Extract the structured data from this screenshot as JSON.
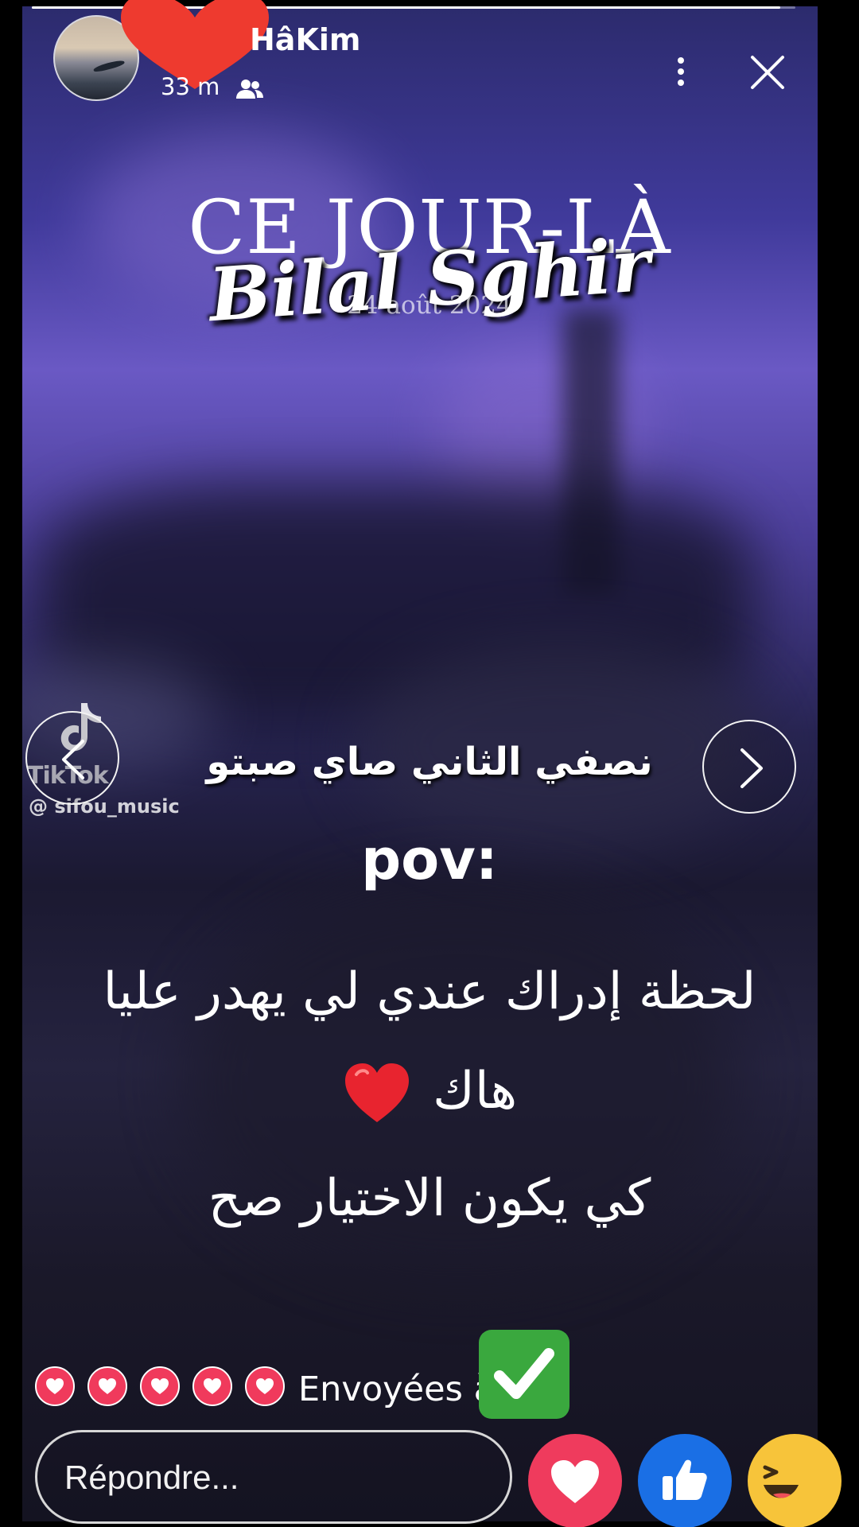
{
  "header": {
    "username": "HâKim",
    "timestamp": "33 m",
    "audience_icon": "friends-icon",
    "more_icon": "more-vertical-icon",
    "close_icon": "close-icon"
  },
  "progress": {
    "value": 0.98
  },
  "story": {
    "title": "CE JOUR-LÀ",
    "artist": "Bilal Sghir",
    "date": "24 août 2024",
    "watermark_brand": "TikTok",
    "watermark_handle": "@ sifou_music",
    "lyric": "نصفي الثاني صاي صبتو",
    "pov": "pov:",
    "line1": "لحظة إدراك عندي لي يهدر عليا",
    "line2": "هاك",
    "line3": "كي يكون الاختيار صح",
    "prev_icon": "chevron-left-icon",
    "next_icon": "chevron-right-icon"
  },
  "footer": {
    "reaction_hearts": [
      "heart-icon",
      "heart-icon",
      "heart-icon",
      "heart-icon",
      "heart-icon"
    ],
    "sent_to_label": "Envoyées à",
    "reply_placeholder": "Répondre...",
    "quick_reactions": [
      "love-icon",
      "like-icon",
      "haha-icon"
    ]
  },
  "colors": {
    "heart_red": "#f03a5c",
    "like_blue": "#1a6fe5",
    "haha_yellow": "#f7c43a",
    "check_green": "#3aa83e"
  }
}
